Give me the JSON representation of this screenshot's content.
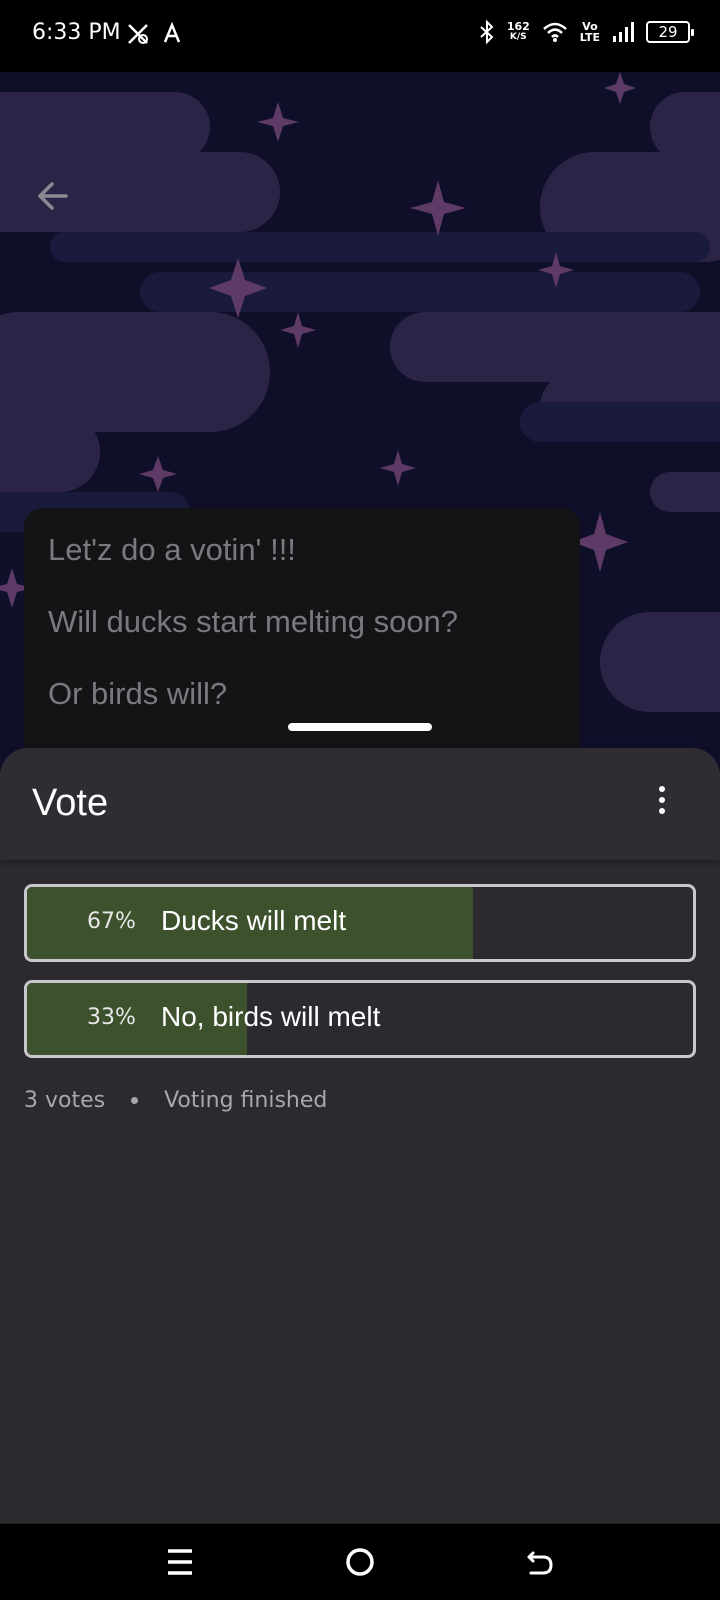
{
  "status_bar": {
    "time": "6:33 PM",
    "net_speed_value": "162",
    "net_speed_unit": "K/S",
    "volte_top": "Vo",
    "volte_bottom": "LTE",
    "battery": "29"
  },
  "description": {
    "lines": [
      "Let'z do a votin' !!!",
      "Will ducks start melting soon?",
      "Or birds will?"
    ]
  },
  "sheet": {
    "title": "Vote"
  },
  "poll": {
    "accent_color": "#3e512d",
    "options": [
      {
        "percent_label": "67%",
        "label": "Ducks will melt",
        "share": 0.67
      },
      {
        "percent_label": "33%",
        "label": "No, birds will melt",
        "share": 0.33
      }
    ],
    "votes": "3 votes",
    "status": "Voting finished"
  },
  "icons": {
    "back": "arrow-left-icon",
    "more": "more-vertical-icon",
    "nav_menu": "menu-icon",
    "nav_home": "home-circle-icon",
    "nav_back": "back-icon"
  }
}
